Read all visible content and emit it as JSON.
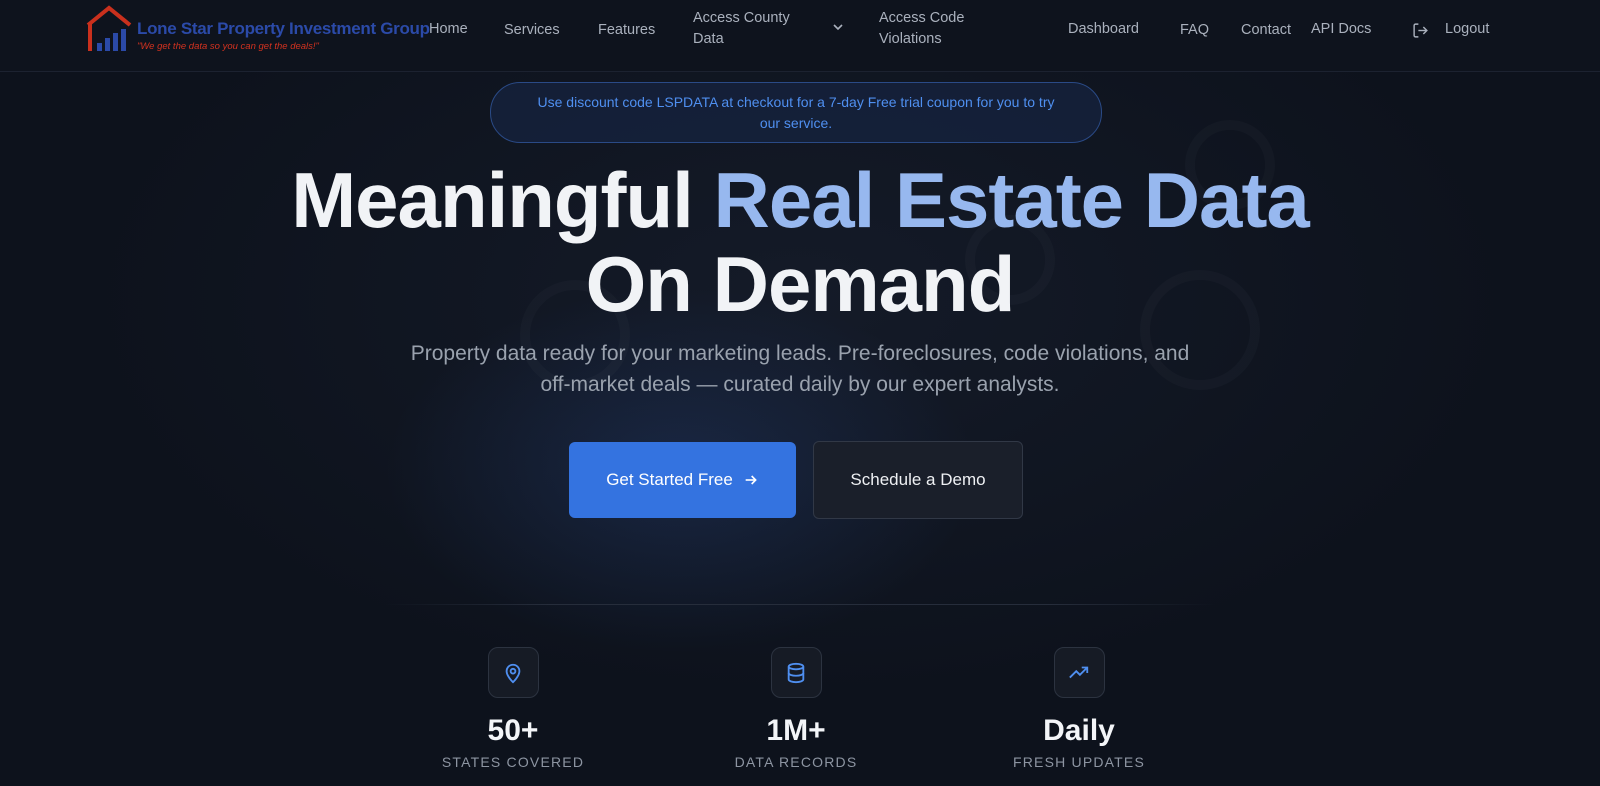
{
  "logo": {
    "name": "Lone Star Property Investment Group",
    "tagline": "\"We get the data so you can get the deals!\""
  },
  "nav": {
    "home": "Home",
    "services": "Services",
    "features": "Features",
    "access_county_data": "Access County Data",
    "access_code_violations": "Access Code Violations",
    "dashboard": "Dashboard",
    "faq": "FAQ",
    "contact": "Contact",
    "api_docs": "API Docs",
    "logout": "Logout"
  },
  "promo": {
    "text": "Use discount code LSPDATA at checkout for a 7-day Free trial coupon for you to try our service."
  },
  "hero": {
    "title_part1": "Meaningful ",
    "title_accent": "Real Estate Data",
    "title_part2": "On Demand",
    "subtitle": "Property data ready for your marketing leads. Pre-foreclosures, code violations, and off-market deals — curated daily by our expert analysts."
  },
  "cta": {
    "primary": "Get Started Free",
    "secondary": "Schedule a Demo"
  },
  "stats": [
    {
      "icon": "map-pin-icon",
      "value": "50+",
      "label": "STATES COVERED"
    },
    {
      "icon": "database-icon",
      "value": "1M+",
      "label": "DATA RECORDS"
    },
    {
      "icon": "trending-up-icon",
      "value": "Daily",
      "label": "FRESH UPDATES"
    }
  ],
  "colors": {
    "background": "#0d121c",
    "accent": "#3473e0",
    "title_accent": "#97b8ef",
    "promo_text": "#4f8ff0",
    "logo_blue": "#2b4aa8",
    "logo_red": "#d2321f"
  }
}
